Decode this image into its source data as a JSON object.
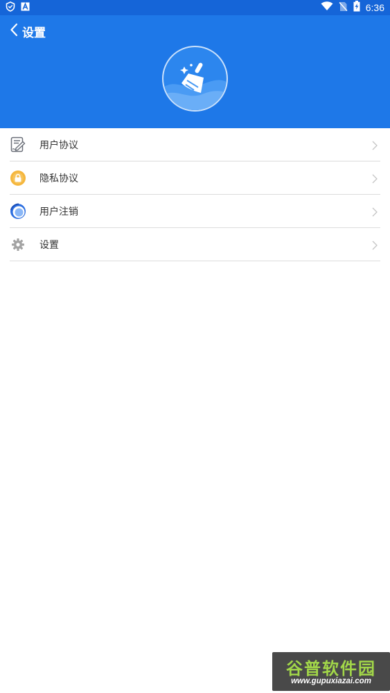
{
  "status_bar": {
    "time": "6:36",
    "icons_left": [
      "shield-icon",
      "app-a-icon"
    ],
    "icons_right": [
      "wifi-icon",
      "no-sim-icon",
      "battery-charging-icon"
    ]
  },
  "header": {
    "title": "设置",
    "back_icon": "chevron-left-icon",
    "logo_icon": "broom-icon",
    "background": "#1e78e8"
  },
  "menu": {
    "items": [
      {
        "label": "用户协议",
        "icon": "document-sign-icon"
      },
      {
        "label": "隐私协议",
        "icon": "privacy-lock-icon"
      },
      {
        "label": "用户注销",
        "icon": "user-cancel-icon"
      },
      {
        "label": "设置",
        "icon": "gear-icon"
      }
    ]
  },
  "watermark": {
    "title": "谷普软件园",
    "url": "www.gupuxiazai.com"
  }
}
